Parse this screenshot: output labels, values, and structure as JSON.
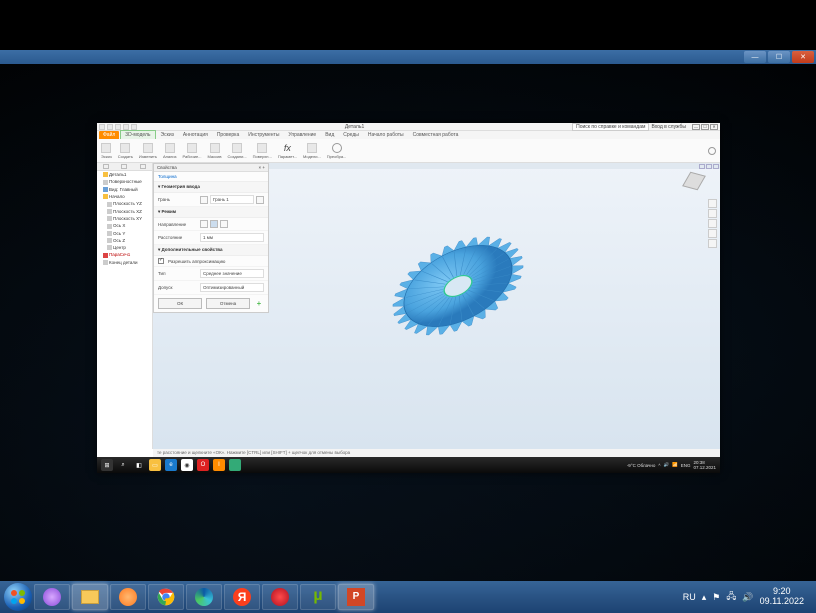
{
  "outer_window": {
    "minimize": "—",
    "maximize": "☐",
    "close": "✕"
  },
  "outer_taskbar": {
    "lang": "RU",
    "time": "9:20",
    "date": "09.11.2022"
  },
  "app": {
    "doc_title": "Деталь1",
    "search_placeholder": "Поиск по справке и командам",
    "signin": "Вход в службы",
    "tabs": {
      "file": "Файл",
      "model3d": "3D-модель",
      "sketch": "Эскиз",
      "annotate": "Аннотация",
      "inspect": "Проверка",
      "tools": "Инструменты",
      "manage": "Управление",
      "view": "Вид",
      "env": "Среды",
      "start": "Начало работы",
      "collab": "Совместная работа"
    },
    "ribbon": {
      "sketch": "Эскиз",
      "create": "Создать",
      "modify": "Изменить",
      "analyze": "Анализ",
      "workfeat": "Рабочие...",
      "pattern": "Массив",
      "createff": "Создани...",
      "surface": "Поверхн...",
      "param": "Парамет...",
      "sim": "Модели...",
      "convert": "Преобра..."
    }
  },
  "browser": {
    "root": "Деталь1",
    "items": [
      "Поверхностные",
      "Вид: Главный",
      "Начало",
      "Плоскость YZ",
      "Плоскость XZ",
      "Плоскость XY",
      "Ось X",
      "Ось Y",
      "Ось Z",
      "Центр"
    ],
    "feature": "ПараСеч1",
    "end": "Конец детали"
  },
  "props": {
    "header": "Свойства",
    "feature_name": "Толщина",
    "sec_geom": "Геометрия ввода",
    "face_lbl": "Грань",
    "face_val": "Грань 1",
    "sec_mode": "Режим",
    "dir_lbl": "Направление",
    "dist_lbl": "Расстояние",
    "dist_val": "1 мм",
    "sec_adv": "Дополнительные свойства",
    "approx_chk": "Разрешить аппроксимацию",
    "type_lbl": "Тип",
    "type_val": "Среднее значение",
    "tol_lbl": "Допуск",
    "tol_val": "Оптимизированный",
    "ok": "ОК",
    "cancel": "Отмена"
  },
  "status": {
    "hint": "те расстояние и щелкните «ОК». Нажмите [CTRL] или [SHIFT] + щелчок для отмены выбора"
  },
  "inner_taskbar": {
    "weather": "-9°C Облачно",
    "lang": "ENG",
    "time": "20:38",
    "date": "07.12.2021"
  }
}
